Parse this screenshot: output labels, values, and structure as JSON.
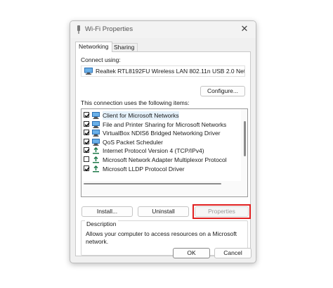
{
  "window": {
    "title": "Wi-Fi Properties",
    "close_glyph": "✕"
  },
  "tabs": [
    {
      "label": "Networking",
      "active": true
    },
    {
      "label": "Sharing",
      "active": false
    }
  ],
  "connect_using": {
    "label": "Connect using:",
    "adapter_name": "Realtek RTL8192FU Wireless LAN 802.11n USB 2.0 Net",
    "adapter_icon": "network-adapter-icon",
    "configure_label": "Configure..."
  },
  "items_section": {
    "label": "This connection uses the following items:",
    "items": [
      {
        "label": "Client for Microsoft Networks",
        "checked": true,
        "icon": "network-client-icon"
      },
      {
        "label": "File and Printer Sharing for Microsoft Networks",
        "checked": true,
        "icon": "network-service-icon"
      },
      {
        "label": "VirtualBox NDIS6 Bridged Networking Driver",
        "checked": true,
        "icon": "network-service-icon"
      },
      {
        "label": "QoS Packet Scheduler",
        "checked": true,
        "icon": "network-service-icon"
      },
      {
        "label": "Internet Protocol Version 4 (TCP/IPv4)",
        "checked": true,
        "icon": "protocol-icon"
      },
      {
        "label": "Microsoft Network Adapter Multiplexor Protocol",
        "checked": false,
        "icon": "protocol-icon"
      },
      {
        "label": "Microsoft LLDP Protocol Driver",
        "checked": true,
        "icon": "protocol-icon"
      }
    ]
  },
  "buttons": {
    "install": "Install...",
    "uninstall": "Uninstall",
    "properties": "Properties",
    "ok": "OK",
    "cancel": "Cancel"
  },
  "description": {
    "legend": "Description",
    "text": "Allows your computer to access resources on a Microsoft network."
  },
  "colors": {
    "highlight": "#e02020",
    "accent": "#1f7a4a",
    "monitor": "#2b6fb3"
  }
}
